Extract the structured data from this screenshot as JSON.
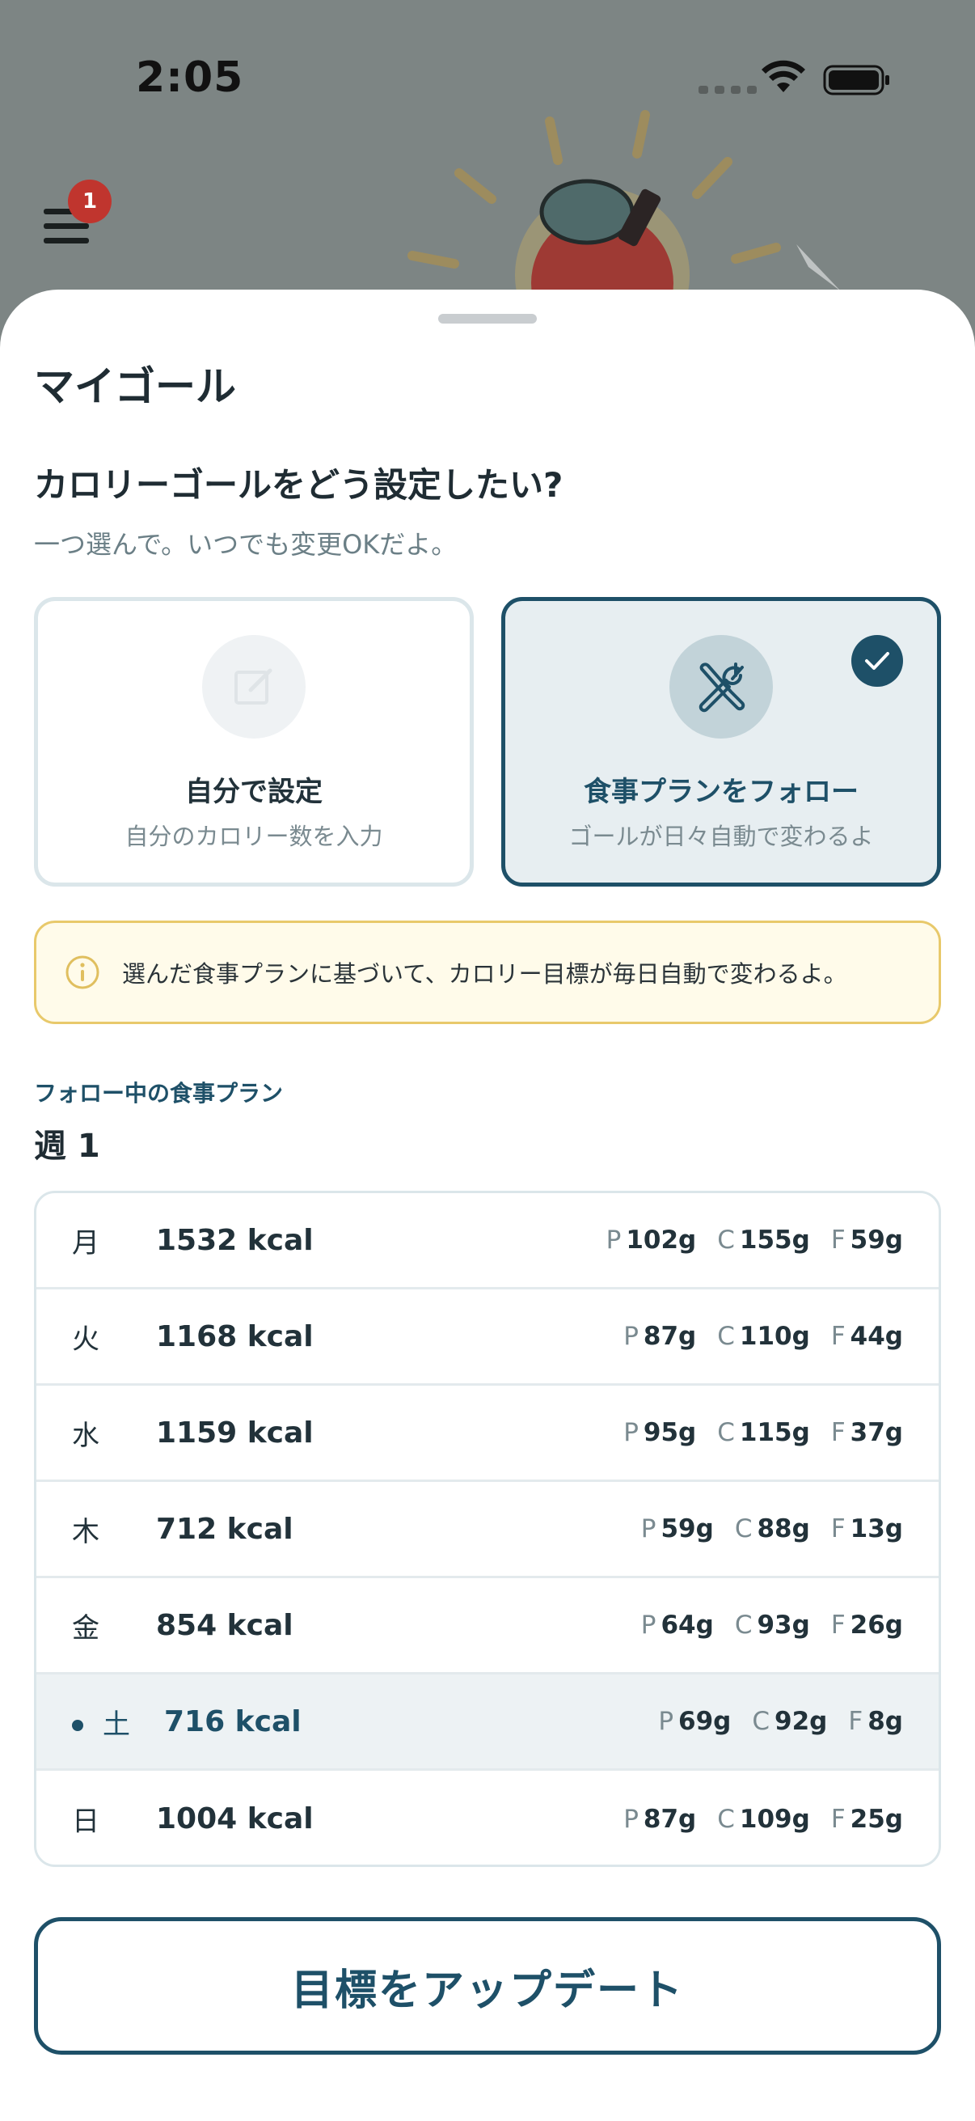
{
  "status_bar": {
    "time": "2:05"
  },
  "header": {
    "menu_badge_count": "1"
  },
  "sheet": {
    "title": "マイゴール",
    "question": "カロリーゴールをどう設定したい?",
    "subtitle": "一つ選んで。いつでも変更OKだよ。"
  },
  "options": {
    "manual": {
      "title": "自分で設定",
      "subtitle": "自分のカロリー数を入力",
      "icon": "edit-icon",
      "selected": false
    },
    "plan": {
      "title": "食事プランをフォロー",
      "subtitle": "ゴールが日々自動で変わるよ",
      "icon": "utensils-icon",
      "selected": true
    }
  },
  "info": {
    "text": "選んだ食事プランに基づいて、カロリー目標が毎日自動で変わるよ。"
  },
  "plan": {
    "label": "フォロー中の食事プラン",
    "week": "週 1",
    "days": [
      {
        "day": "月",
        "kcal": "1532 kcal",
        "p": "102g",
        "c": "155g",
        "f": "59g"
      },
      {
        "day": "火",
        "kcal": "1168 kcal",
        "p": "87g",
        "c": "110g",
        "f": "44g"
      },
      {
        "day": "水",
        "kcal": "1159 kcal",
        "p": "95g",
        "c": "115g",
        "f": "37g"
      },
      {
        "day": "木",
        "kcal": "712 kcal",
        "p": "59g",
        "c": "88g",
        "f": "13g"
      },
      {
        "day": "金",
        "kcal": "854 kcal",
        "p": "64g",
        "c": "93g",
        "f": "26g"
      },
      {
        "day": "土",
        "kcal": "716 kcal",
        "p": "69g",
        "c": "92g",
        "f": "8g"
      },
      {
        "day": "日",
        "kcal": "1004 kcal",
        "p": "87g",
        "c": "109g",
        "f": "25g"
      }
    ],
    "macro_keys": {
      "p": "P",
      "c": "C",
      "f": "F"
    }
  },
  "actions": {
    "update_label": "目標をアップデート"
  },
  "colors": {
    "accent": "#1e5068",
    "badge": "#c0352e",
    "info_border": "#e8c96b"
  }
}
